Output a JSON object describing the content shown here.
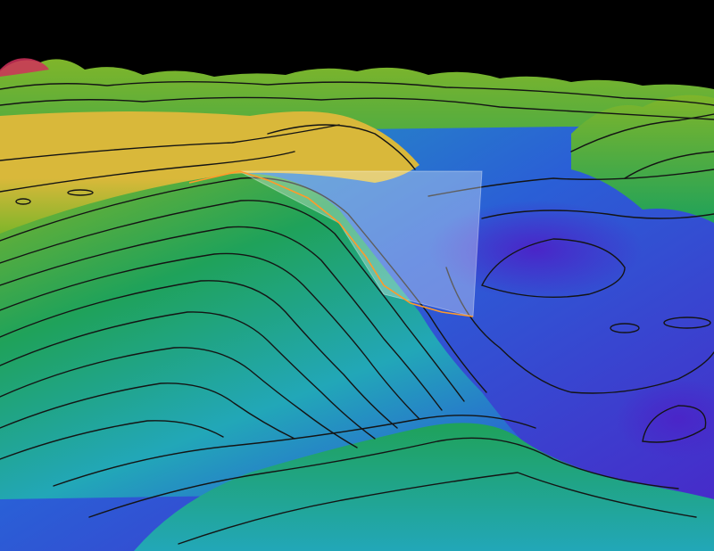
{
  "image": {
    "subject": "3d-bathymetry-visualization",
    "palette": {
      "sky": "#000000",
      "shallow": "#d9b83a",
      "mid_shallow": "#7fb52a",
      "mid": "#1fa25a",
      "mid_deep": "#22a7b8",
      "deep": "#2a5fd6",
      "deepest": "#4a25c8",
      "peak": "#d0305a",
      "contour": "#141414",
      "profile_line": "#ff9a2a",
      "profile_panel": "#ffffff"
    }
  }
}
